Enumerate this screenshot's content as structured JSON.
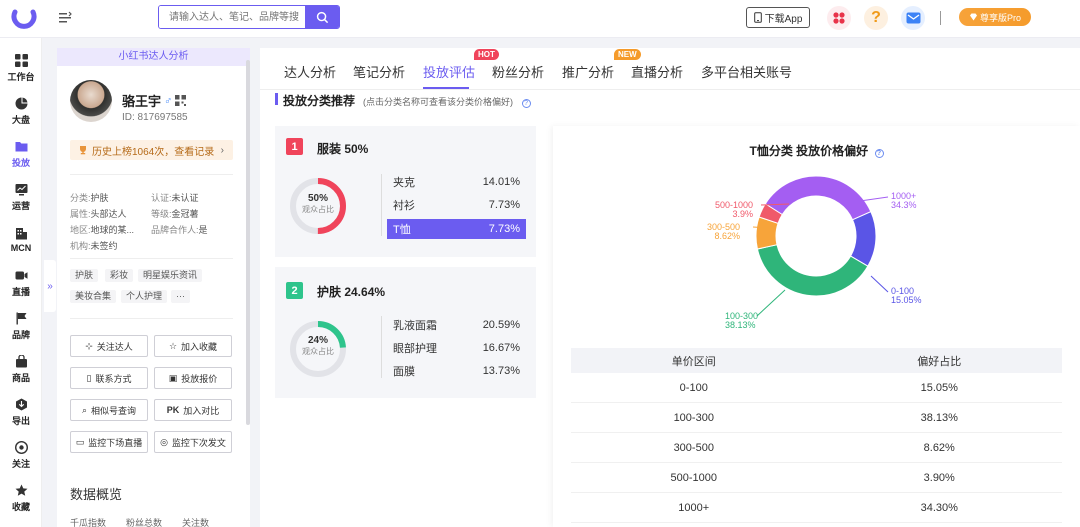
{
  "topbar": {
    "search_placeholder": "请输入达人、笔记、品牌等搜",
    "download_label": "下载App",
    "help_symbol": "?",
    "pro_label": "尊享版Pro"
  },
  "nav": {
    "items": [
      {
        "label": "工作台",
        "icon": "grid-icon"
      },
      {
        "label": "大盘",
        "icon": "pie-chart-icon"
      },
      {
        "label": "投放",
        "icon": "folder-icon"
      },
      {
        "label": "运营",
        "icon": "monitor-chart-icon"
      },
      {
        "label": "MCN",
        "icon": "building-icon"
      },
      {
        "label": "直播",
        "icon": "video-icon"
      },
      {
        "label": "品牌",
        "icon": "flag-icon"
      },
      {
        "label": "商品",
        "icon": "bag-icon"
      },
      {
        "label": "导出",
        "icon": "export-icon"
      },
      {
        "label": "关注",
        "icon": "eye-icon"
      },
      {
        "label": "收藏",
        "icon": "star-icon"
      }
    ],
    "collapse_symbol": "»"
  },
  "profile": {
    "header": "小红书达人分析",
    "name": "骆王宇",
    "gender_symbol": "♂",
    "id_text": "ID: 817697585",
    "history": "历史上榜1064次，查看记录",
    "history_arrow": "›",
    "fields": {
      "category": {
        "k": "分类:",
        "v": "护肤"
      },
      "certified": {
        "k": "认证:",
        "v": "未认证"
      },
      "attribute": {
        "k": "属性:",
        "v": "头部达人"
      },
      "level": {
        "k": "等级:",
        "v": "金冠薯"
      },
      "region": {
        "k": "地区:",
        "v": "地球的某..."
      },
      "brand_partner": {
        "k": "品牌合作人:",
        "v": "是"
      },
      "agency": {
        "k": "机构:",
        "v": "未签约"
      }
    },
    "tags": [
      "护肤",
      "彩妆",
      "明星娱乐资讯",
      "美妆合集",
      "个人护理",
      "···"
    ],
    "actions": {
      "follow": "关注达人",
      "collect": "加入收藏",
      "contact": "联系方式",
      "quote": "投放报价",
      "similar": "相似号查询",
      "compare": "加入对比",
      "monitor_live": "监控下场直播",
      "monitor_post": "监控下次发文"
    },
    "data_overview": "数据概览",
    "mini_labels": [
      "千瓜指数",
      "粉丝总数",
      "关注数"
    ]
  },
  "tabs": {
    "t1": "达人分析",
    "t2": "笔记分析",
    "t3": "投放评估",
    "t4": "粉丝分析",
    "t5": "推广分析",
    "t6": "直播分析",
    "t7": "多平台相关账号",
    "hot": "HOT",
    "new": "NEW"
  },
  "section": {
    "title": "投放分类推荐",
    "hint": "(点击分类名称可查看该分类价格偏好)",
    "info": "?"
  },
  "categories": [
    {
      "rank": "1",
      "title": "服装 50%",
      "share_pct": 50,
      "ring_pct": "50%",
      "ring_label": "观众占比",
      "color": "#f0445b",
      "subs": [
        {
          "name": "夹克",
          "value": "14.01%"
        },
        {
          "name": "衬衫",
          "value": "7.73%"
        },
        {
          "name": "T恤",
          "value": "7.73%"
        }
      ]
    },
    {
      "rank": "2",
      "title": "护肤 24.64%",
      "share_pct": 24,
      "ring_pct": "24%",
      "ring_label": "观众占比",
      "color": "#2ec48c",
      "subs": [
        {
          "name": "乳液面霜",
          "value": "20.59%"
        },
        {
          "name": "眼部护理",
          "value": "16.67%"
        },
        {
          "name": "面膜",
          "value": "13.73%"
        }
      ]
    }
  ],
  "chart_data": {
    "type": "pie",
    "title": "T恤分类 投放价格偏好",
    "categories": [
      "0-100",
      "100-300",
      "300-500",
      "500-1000",
      "1000+"
    ],
    "values": [
      15.05,
      38.13,
      8.62,
      3.9,
      34.3
    ],
    "labels": [
      "15.05%",
      "38.13%",
      "8.62%",
      "3.9%",
      "34.3%"
    ],
    "colors": [
      "#5a55e6",
      "#2fb57a",
      "#f7a43a",
      "#f0596a",
      "#a45ef2"
    ]
  },
  "table": {
    "headers": [
      "单价区间",
      "偏好占比"
    ],
    "rows": [
      [
        "0-100",
        "15.05%"
      ],
      [
        "100-300",
        "38.13%"
      ],
      [
        "300-500",
        "8.62%"
      ],
      [
        "500-1000",
        "3.90%"
      ],
      [
        "1000+",
        "34.30%"
      ]
    ]
  }
}
